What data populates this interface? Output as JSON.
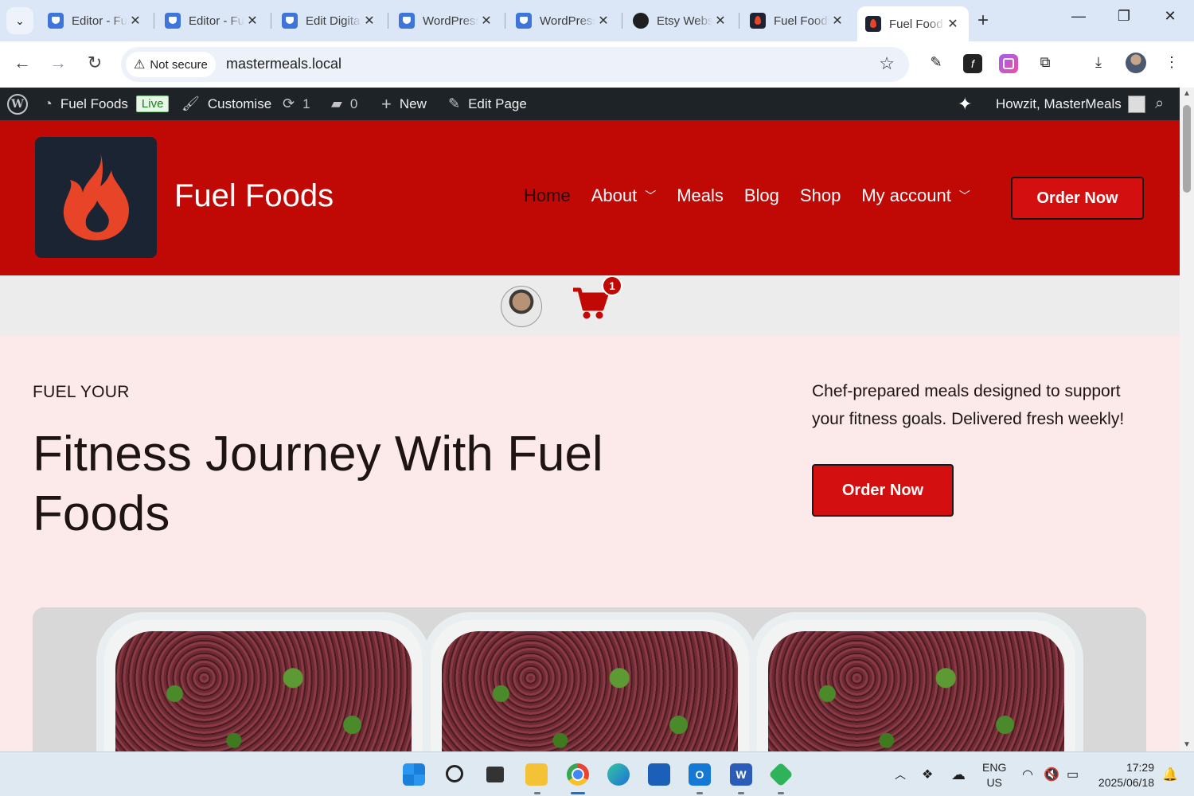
{
  "browser": {
    "tabs": [
      {
        "title": "Editor - Fuel Foods",
        "favicon": "wordpress-icon"
      },
      {
        "title": "Editor - Fuel Foods",
        "favicon": "wordpress-icon"
      },
      {
        "title": "Edit Digital Product",
        "favicon": "wordpress-icon"
      },
      {
        "title": "WordPress",
        "favicon": "wordpress-icon"
      },
      {
        "title": "WordPress",
        "favicon": "wordpress-icon"
      },
      {
        "title": "Etsy Website",
        "favicon": "openai-icon"
      },
      {
        "title": "Fuel Foods",
        "favicon": "fuel-foods-icon"
      },
      {
        "title": "Fuel Foods",
        "favicon": "fuel-foods-icon",
        "active": true
      }
    ],
    "close_glyph": "✕",
    "new_tab_glyph": "+",
    "window_controls": {
      "minimize": "—",
      "restore": "❐",
      "close": "✕"
    },
    "security_label": "Not secure",
    "url": "mastermeals.local"
  },
  "adminbar": {
    "site_name": "Fuel Foods",
    "live_badge": "Live",
    "customise": "Customise",
    "updates_count": "1",
    "comments_count": "0",
    "new_label": "New",
    "edit_page": "Edit Page",
    "greeting": "Howzit, MasterMeals"
  },
  "site": {
    "title": "Fuel Foods",
    "nav": [
      {
        "label": "Home",
        "current": true
      },
      {
        "label": "About",
        "dropdown": true
      },
      {
        "label": "Meals"
      },
      {
        "label": "Blog"
      },
      {
        "label": "Shop"
      },
      {
        "label": "My account",
        "dropdown": true
      }
    ],
    "order_button": "Order Now",
    "cart_count": "1",
    "brand_color": "#c00805"
  },
  "hero": {
    "kicker": "FUEL YOUR",
    "title": "Fitness Journey With Fuel Foods",
    "description": "Chef-prepared meals designed to support your fitness goals. Delivered fresh weekly!",
    "button": "Order Now"
  },
  "taskbar": {
    "language_top": "ENG",
    "language_bottom": "US",
    "time": "17:29",
    "date": "2025/06/18"
  }
}
